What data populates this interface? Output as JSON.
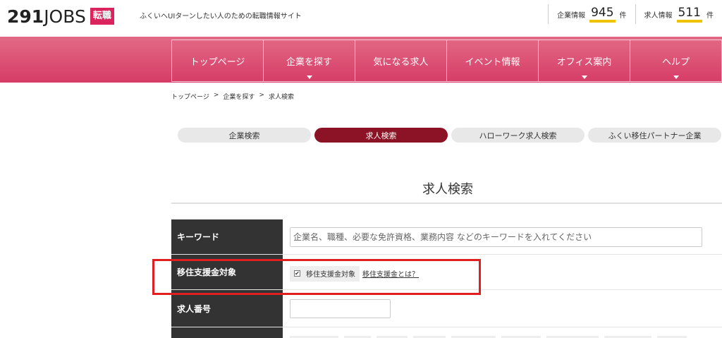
{
  "header": {
    "logo_main": "291",
    "logo_sub": "JOBS",
    "logo_badge": "転職",
    "tagline": "ふくいへUIターンしたい人のための転職情報サイト",
    "company_label": "企業情報",
    "company_count": "945",
    "company_unit": "件",
    "job_label": "求人情報",
    "job_count": "511",
    "job_unit": "件"
  },
  "nav": {
    "items": [
      {
        "label": "トップページ",
        "has_dropdown": false
      },
      {
        "label": "企業を探す",
        "has_dropdown": true
      },
      {
        "label": "気になる求人",
        "has_dropdown": false
      },
      {
        "label": "イベント情報",
        "has_dropdown": false
      },
      {
        "label": "オフィス案内",
        "has_dropdown": true
      },
      {
        "label": "ヘルプ",
        "has_dropdown": true
      }
    ]
  },
  "breadcrumb": {
    "items": [
      "トップページ",
      "企業を探す",
      "求人検索"
    ],
    "separator": ">"
  },
  "tabs": [
    {
      "label": "企業検索",
      "active": false
    },
    {
      "label": "求人検索",
      "active": true
    },
    {
      "label": "ハローワーク求人検索",
      "active": false
    },
    {
      "label": "ふくい移住パートナー企業",
      "active": false
    }
  ],
  "section_title": "求人検索",
  "form": {
    "keyword_label": "キーワード",
    "keyword_placeholder": "企業名、職種、必要な免許資格、業務内容 などのキーワードを入れてください",
    "relocation_label": "移住支援金対象",
    "relocation_checkbox_label": "移住支援金対象",
    "relocation_checked": true,
    "relocation_link": "移住支援金とは？",
    "job_number_label": "求人番号",
    "job_number_value": ""
  },
  "colors": {
    "brand_pink": "#d63c66",
    "active_tab": "#8b1325",
    "counter_underline": "#f0c300",
    "highlight_red": "#e02020"
  }
}
